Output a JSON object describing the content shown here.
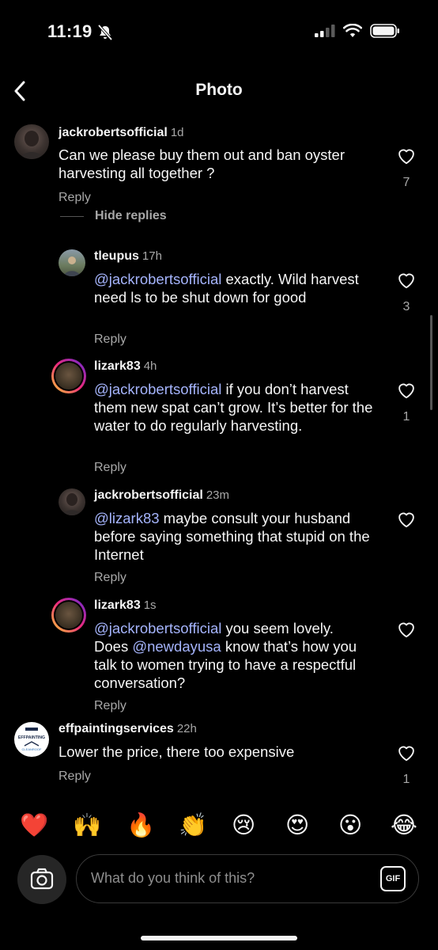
{
  "status": {
    "time": "11:19"
  },
  "header": {
    "title": "Photo"
  },
  "comments": [
    {
      "username": "jackrobertsofficial",
      "time": "1d",
      "mention": "",
      "text": "Can we please buy them out and ban oyster harvesting all together ?",
      "likes": "7",
      "reply_label": "Reply"
    },
    {
      "username": "tleupus",
      "time": "17h",
      "mention": "@jackrobertsofficial",
      "text": " exactly. Wild harvest need ls to be shut down for good",
      "likes": "3",
      "reply_label": "Reply"
    },
    {
      "username": "lizark83",
      "time": "4h",
      "mention": "@jackrobertsofficial",
      "text": " if you don’t harvest them new spat can’t grow.  It’s better for the water to do regularly harvesting.",
      "likes": "1",
      "reply_label": "Reply"
    },
    {
      "username": "jackrobertsofficial",
      "time": "23m",
      "mention": "@lizark83",
      "text": " maybe consult your husband before saying something that stupid on the Internet",
      "likes": "",
      "reply_label": "Reply"
    },
    {
      "username": "lizark83",
      "time": "1s",
      "mention": "@jackrobertsofficial",
      "text": " you seem lovely. Does ",
      "mention2": "@newdayusa",
      "text2": " know that’s how you talk to women trying to have a respectful conversation?",
      "likes": "",
      "reply_label": "Reply"
    },
    {
      "username": "effpaintingservices",
      "time": "22h",
      "mention": "",
      "text": "Lower the price, there too expensive",
      "likes": "1",
      "reply_label": "Reply"
    }
  ],
  "hide_replies": "Hide replies",
  "avatar_logo": {
    "line1": "EFFPAINTING",
    "line2": "CLEANROOF"
  },
  "emojis": [
    {
      "name": "red-heart",
      "glyph": "❤️"
    },
    {
      "name": "raising-hands",
      "glyph": "🙌"
    },
    {
      "name": "fire",
      "glyph": "🔥"
    },
    {
      "name": "clapping-hands",
      "glyph": "👏"
    },
    {
      "name": "crying-face",
      "glyph": "😢"
    },
    {
      "name": "heart-eyes",
      "glyph": "😍"
    },
    {
      "name": "astonished-face",
      "glyph": "😮"
    },
    {
      "name": "tears-of-joy",
      "glyph": "😂"
    }
  ],
  "composer": {
    "placeholder": "What do you think of this?",
    "gif_label": "GIF"
  },
  "colors": {
    "background": "#000000",
    "mention": "#a5b4fc",
    "muted": "#a8a8a8"
  }
}
